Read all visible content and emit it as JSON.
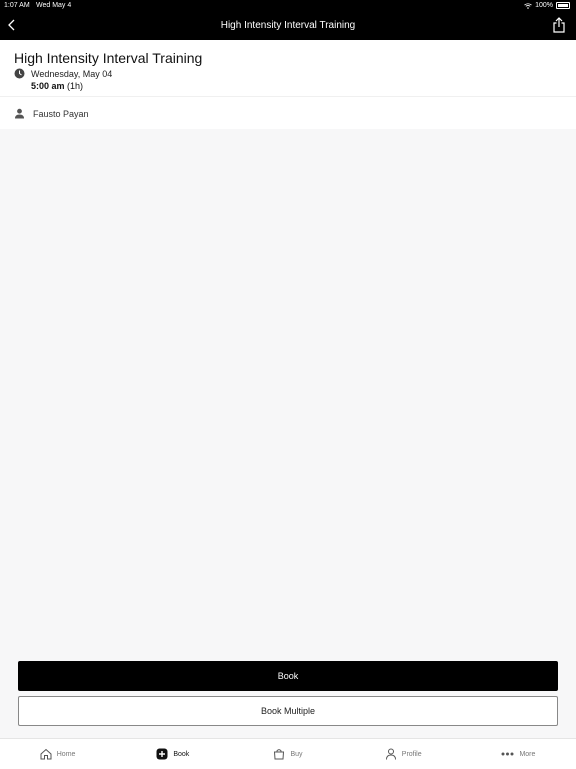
{
  "status_bar": {
    "time": "1:07 AM",
    "date": "Wed May 4",
    "battery": "100%"
  },
  "nav": {
    "title": "High Intensity Interval Training"
  },
  "class": {
    "title": "High Intensity Interval Training",
    "date": "Wednesday, May 04",
    "time": "5:00 am",
    "duration": "(1h)",
    "instructor": "Fausto Payan"
  },
  "actions": {
    "book_label": "Book",
    "book_multiple_label": "Book Multiple"
  },
  "tabs": [
    {
      "label": "Home",
      "icon": "home-icon"
    },
    {
      "label": "Book",
      "icon": "plus-circle-icon"
    },
    {
      "label": "Buy",
      "icon": "bag-icon"
    },
    {
      "label": "Profile",
      "icon": "person-icon"
    },
    {
      "label": "More",
      "icon": "ellipsis-icon"
    }
  ],
  "colors": {
    "nav_bg": "#000000",
    "primary_button": "#000000",
    "page_bg": "#f7f7f8"
  }
}
